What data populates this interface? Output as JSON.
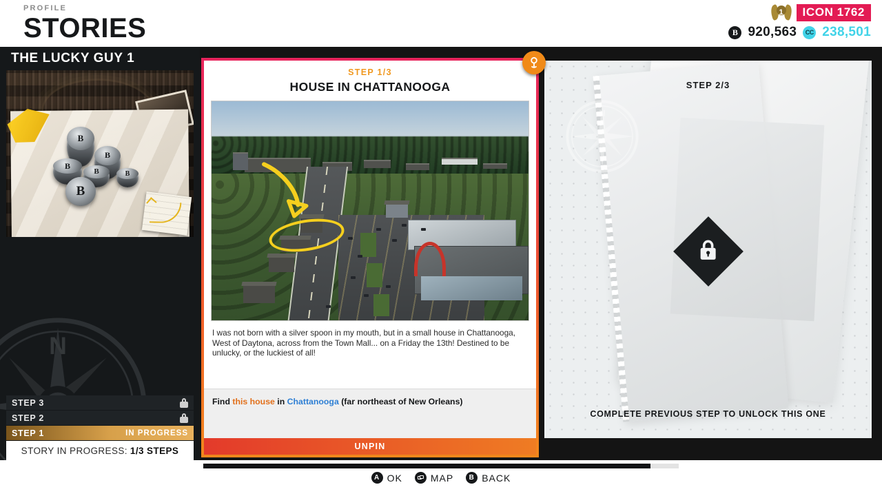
{
  "header": {
    "kicker": "PROFILE",
    "title": "STORIES",
    "level_badge": "1",
    "icon_rank": "ICON 1762",
    "credits_icon": "B",
    "credits": "920,563",
    "cc_icon": "CC",
    "cc_amount": "238,501",
    "accent_pink": "#e31b54",
    "accent_cyan": "#41d3e8"
  },
  "left_panel": {
    "story_title": "THE LUCKY GUY 1",
    "steps": [
      {
        "label": "STEP 3",
        "state": "locked",
        "right": ""
      },
      {
        "label": "STEP 2",
        "state": "locked",
        "right": ""
      },
      {
        "label": "STEP 1",
        "state": "current",
        "right": "IN PROGRESS"
      }
    ],
    "progress_label": "STORY IN PROGRESS:",
    "progress_value": "1/3 STEPS",
    "coin_glyph": "B",
    "compass_north": "N"
  },
  "center_card": {
    "step_counter": "STEP 1/3",
    "title": "HOUSE IN CHATTANOOGA",
    "description": "I was not born with a silver spoon in my mouth, but in a small house in Chattanooga, West of Daytona, across from the Town Mall... on a Friday the 13th! Destined to be unlucky, or the luckiest of all!",
    "hint": {
      "prefix": "Find ",
      "target": "this house",
      "middle": " in ",
      "place": "Chattanooga",
      "suffix": " (far northeast of New Orleans)"
    },
    "action_label": "UNPIN",
    "pin_icon": "map-pin-icon",
    "border_top_color": "#e8245c",
    "border_bottom_color": "#f2871c"
  },
  "right_panel": {
    "step_counter": "STEP 2/3",
    "locked_message": "COMPLETE PREVIOUS STEP TO UNLOCK THIS ONE",
    "lock_icon": "lock-icon",
    "compass_north": "N"
  },
  "bottom_bar": {
    "scroll_percent": 94,
    "prompts": [
      {
        "button": "A",
        "label": "OK"
      },
      {
        "button": "view",
        "label": "MAP"
      },
      {
        "button": "B",
        "label": "BACK"
      }
    ]
  }
}
